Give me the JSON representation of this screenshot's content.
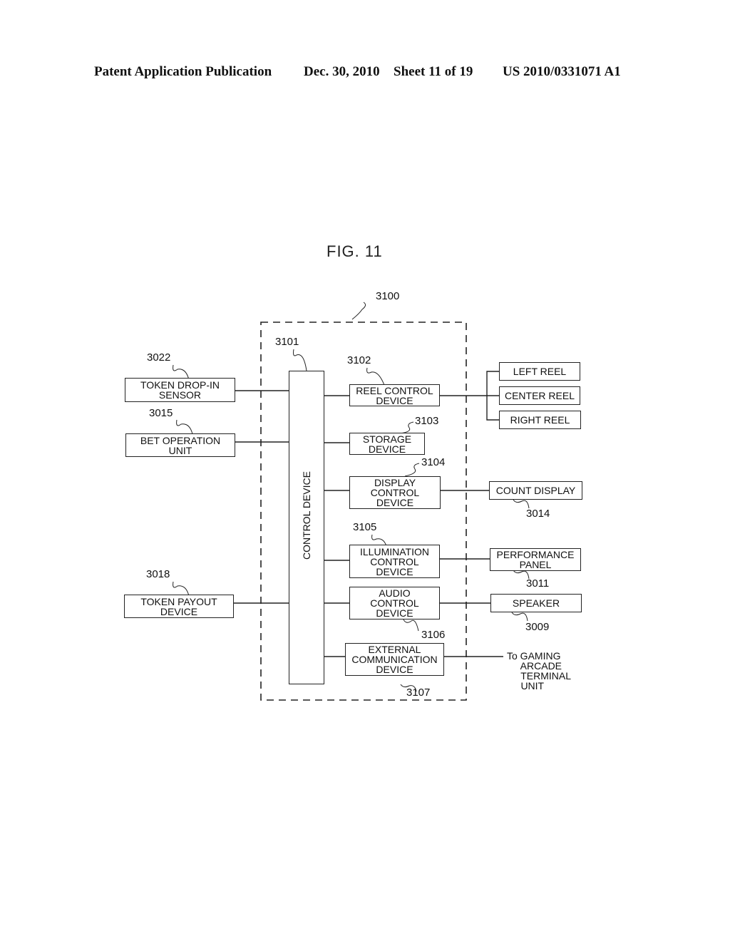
{
  "header": {
    "publication": "Patent Application Publication",
    "date": "Dec. 30, 2010",
    "sheet": "Sheet 11 of 19",
    "number": "US 2010/0331071 A1"
  },
  "figure": {
    "title": "FIG. 11",
    "enclosure_ref": "3100",
    "control_device": {
      "ref": "3101",
      "label": "CONTROL DEVICE"
    },
    "inputs": [
      {
        "ref": "3022",
        "label": "TOKEN DROP-IN\nSENSOR"
      },
      {
        "ref": "3015",
        "label": "BET OPERATION\nUNIT"
      },
      {
        "ref": "3018",
        "label": "TOKEN PAYOUT\nDEVICE"
      }
    ],
    "sub_devices": [
      {
        "ref": "3102",
        "label": "REEL CONTROL\nDEVICE"
      },
      {
        "ref": "3103",
        "label": "STORAGE\nDEVICE"
      },
      {
        "ref": "3104",
        "label": "DISPLAY\nCONTROL\nDEVICE"
      },
      {
        "ref": "3105",
        "label": "ILLUMINATION\nCONTROL\nDEVICE"
      },
      {
        "ref": "3106",
        "label": "AUDIO\nCONTROL\nDEVICE"
      },
      {
        "ref": "3107",
        "label": "EXTERNAL\nCOMMUNICATION\nDEVICE"
      }
    ],
    "reels": [
      {
        "label": "LEFT REEL"
      },
      {
        "label": "CENTER REEL"
      },
      {
        "label": "RIGHT REEL"
      }
    ],
    "outputs": [
      {
        "ref": "3014",
        "label": "COUNT DISPLAY"
      },
      {
        "ref": "3011",
        "label": "PERFORMANCE\nPANEL"
      },
      {
        "ref": "3009",
        "label": "SPEAKER"
      }
    ],
    "external_target": "To GAMING\n     ARCADE\n     TERMINAL\n     UNIT"
  }
}
